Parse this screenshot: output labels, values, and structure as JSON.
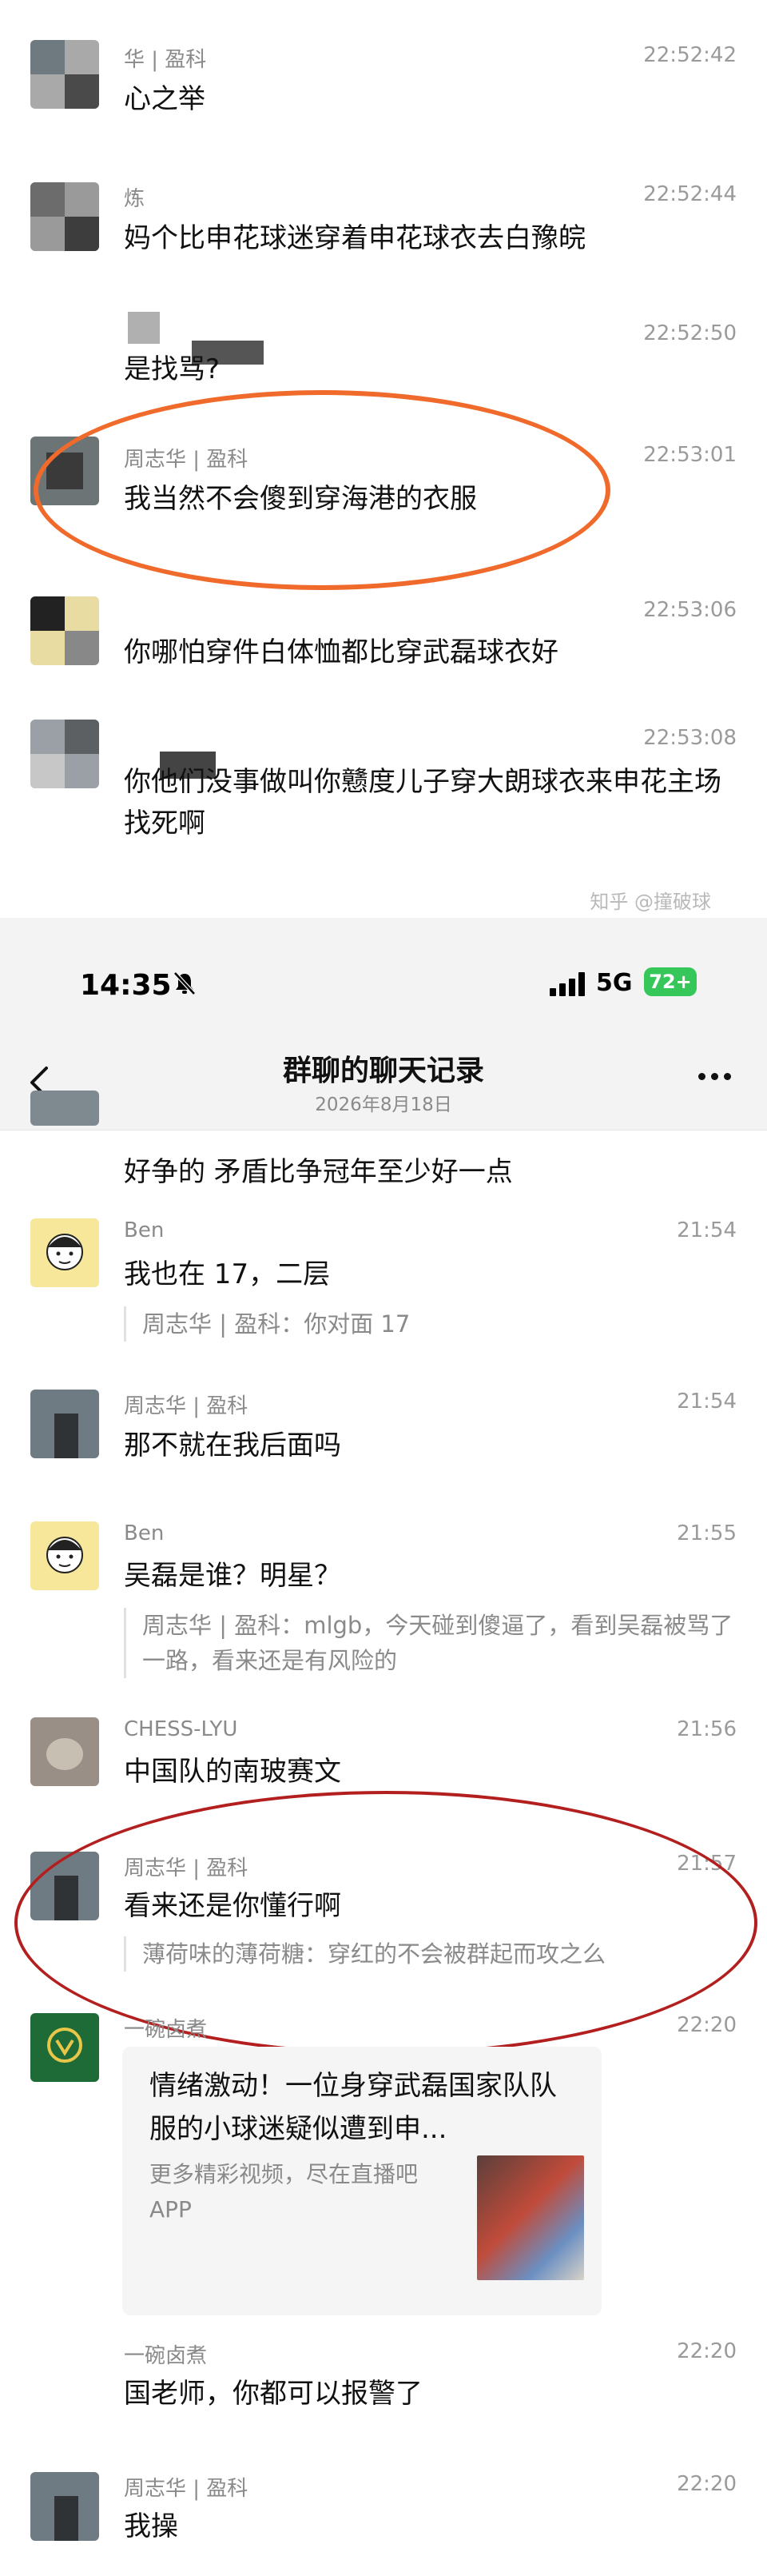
{
  "top_chat": {
    "messages": [
      {
        "sender": "华 | 盈科",
        "time": "22:52:42",
        "text": "心之举"
      },
      {
        "sender": "炼",
        "time": "22:52:44",
        "text": "妈个比申花球迷穿着申花球衣去白豫皖"
      },
      {
        "sender": "",
        "time": "22:52:50",
        "text": "是找骂?"
      },
      {
        "sender": "周志华 | 盈科",
        "time": "22:53:01",
        "text": "我当然不会傻到穿海港的衣服"
      },
      {
        "sender": "",
        "time": "22:53:06",
        "text": "你哪怕穿件白体恤都比穿武磊球衣好"
      },
      {
        "sender": "",
        "time": "22:53:08",
        "text": "你他们没事做叫你戆度儿子穿大朗球衣来申花主场找死啊"
      }
    ],
    "watermark": "知乎 @撞破球"
  },
  "status_bar": {
    "clock": "14:35",
    "network": "5G",
    "battery": "72+"
  },
  "nav": {
    "title": "群聊的聊天记录",
    "subtitle": "2026年8月18日"
  },
  "bottom_chat": {
    "partial_text": "好争的 矛盾比争冠年至少好一点",
    "messages": [
      {
        "sender": "Ben",
        "time": "21:54",
        "text": "我也在 17，二层",
        "quote": "周志华 | 盈科：你对面 17"
      },
      {
        "sender": "周志华 | 盈科",
        "time": "21:54",
        "text": "那不就在我后面吗",
        "quote": ""
      },
      {
        "sender": "Ben",
        "time": "21:55",
        "text": "吴磊是谁？明星？",
        "quote": "周志华 | 盈科：mlgb，今天碰到傻逼了，看到吴磊被骂了一路，看来还是有风险的"
      },
      {
        "sender": "CHESS-LYU",
        "time": "21:56",
        "text": "中国队的南玻赛文",
        "quote": ""
      },
      {
        "sender": "周志华 | 盈科",
        "time": "21:57",
        "text": "看来还是你懂行啊",
        "quote": "薄荷味的薄荷糖：穿红的不会被群起而攻之么"
      },
      {
        "sender": "一碗卤煮",
        "time": "22:20",
        "text": "",
        "quote": ""
      },
      {
        "sender": "一碗卤煮",
        "time": "22:20",
        "text": "国老师，你都可以报警了",
        "quote": ""
      },
      {
        "sender": "周志华 | 盈科",
        "time": "22:20",
        "text": "我操",
        "quote": ""
      }
    ],
    "card": {
      "title": "情绪激动！一位身穿武磊国家队队服的小球迷疑似遭到申...",
      "desc": "更多精彩视频，尽在直播吧APP"
    }
  },
  "colors": {
    "annotation_top": "#f06a2c",
    "annotation_bottom": "#b31f1f",
    "battery": "#35c759"
  }
}
